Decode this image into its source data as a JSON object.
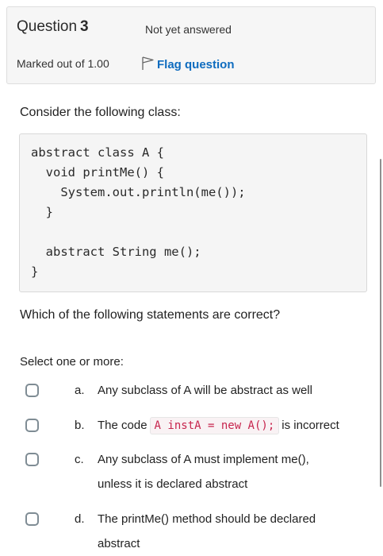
{
  "info": {
    "question_word": "Question",
    "question_number": "3",
    "state": "Not yet answered",
    "grade": "Marked out of 1.00",
    "flag_label": "Flag question"
  },
  "prompt": "Consider the following class:",
  "code_lines": [
    "abstract class A {",
    "  void printMe() {",
    "    System.out.println(me());",
    "  }",
    "",
    "  abstract String me();",
    "}"
  ],
  "question": "Which of the following statements are correct?",
  "select_label": "Select one or more:",
  "options": [
    {
      "letter": "a.",
      "text": "Any subclass of A will be abstract as well",
      "checked": false
    },
    {
      "letter": "b.",
      "text_before": "The code",
      "code": "A instA = new A();",
      "text_after": "is incorrect",
      "checked": false
    },
    {
      "letter": "c.",
      "text": "Any subclass of A must implement me(),",
      "text2": "unless it is declared abstract",
      "checked": false
    },
    {
      "letter": "d.",
      "text": "The printMe() method should be declared",
      "text2": "abstract",
      "checked": false
    }
  ],
  "icons": {
    "flag": "flag-icon"
  },
  "colors": {
    "link": "#0f6cbf",
    "code": "#c7254e",
    "checkbox_border": "#7f8c94"
  }
}
